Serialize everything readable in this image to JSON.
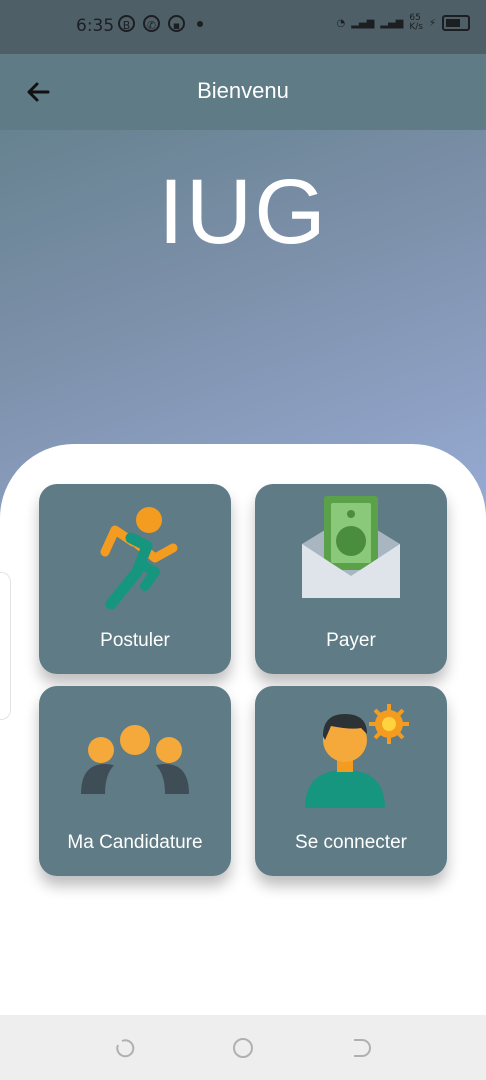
{
  "status": {
    "time": "6:35",
    "network_rate": "65\nK/s"
  },
  "appbar": {
    "title": "Bienvenu"
  },
  "brand": {
    "name": "IUG"
  },
  "tiles": [
    {
      "label": "Postuler",
      "icon": "runner-icon"
    },
    {
      "label": "Payer",
      "icon": "money-envelope-icon"
    },
    {
      "label": "Ma Candidature",
      "icon": "group-icon"
    },
    {
      "label": "Se connecter",
      "icon": "user-sun-icon"
    }
  ],
  "colors": {
    "tile": "#5f7b86",
    "appbar": "#5f7b86",
    "accent_orange": "#f39c1f",
    "accent_green": "#16967f"
  }
}
